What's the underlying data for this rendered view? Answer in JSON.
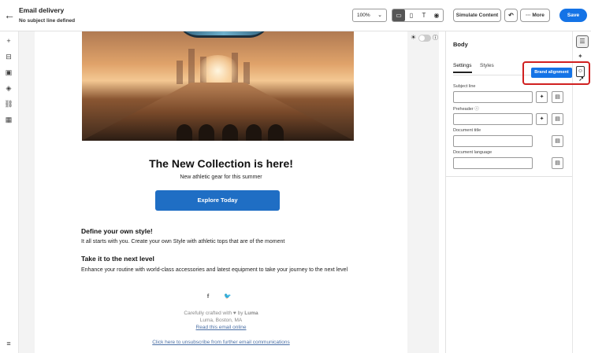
{
  "header": {
    "title": "Email delivery",
    "subtitle": "No subject line defined",
    "zoom": "100%",
    "simulate_label": "Simulate Content",
    "more_label": "More",
    "save_label": "Save"
  },
  "email": {
    "heading": "The New Collection is here!",
    "subheading": "New athletic gear for this summer",
    "cta_label": "Explore Today",
    "section1_title": "Define your own style!",
    "section1_body": "It all starts with you. Create your own Style with athletic tops that are of the moment",
    "section2_title": "Take it to the next level",
    "section2_body": "Enhance your routine with world-class accessories and latest equipment to take your journey to the next level",
    "footer_crafted_prefix": "Carefully crafted with",
    "footer_heart": "♥",
    "footer_by": "by",
    "footer_brand": "Luma",
    "footer_location": "Luma, Boston, MA",
    "footer_read_online": "Read this email online",
    "footer_unsubscribe": "Click here to unsubscribe from further email communications"
  },
  "panel": {
    "title": "Body",
    "tabs": [
      {
        "label": "Settings",
        "active": true
      },
      {
        "label": "Styles",
        "active": false
      }
    ],
    "fields": [
      {
        "label": "Subject line",
        "value": ""
      },
      {
        "label": "Preheader",
        "value": ""
      },
      {
        "label": "Document title",
        "value": ""
      },
      {
        "label": "Document language",
        "value": ""
      }
    ]
  },
  "tooltip": {
    "text": "Brand alignment"
  },
  "colors": {
    "accent": "#1473e6",
    "cta": "#1f6ec4",
    "highlight": "#d02020"
  }
}
